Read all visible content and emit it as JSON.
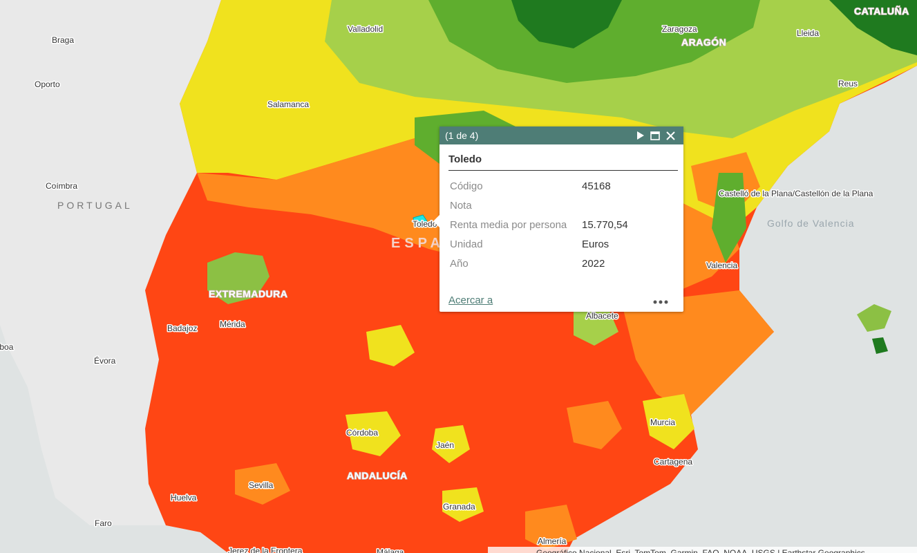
{
  "map": {
    "colors": {
      "sea": "#dfe3e3",
      "land_other": "#e8e8e8",
      "class_1": "#ff4614",
      "class_2": "#ff8a1e",
      "class_3": "#f0e21e",
      "class_4": "#a6d04a",
      "class_5": "#5fae2e",
      "class_6": "#1f7a1f",
      "selected": "#1ee6e6"
    },
    "labels": {
      "cities": [
        "Braga",
        "Oporto",
        "Valladolid",
        "Zaragoza",
        "Lleida",
        "Reus",
        "Salamanca",
        "Coímbra",
        "Toledo",
        "Castelló de la Plana/Castellón de la Plana",
        "Valencia",
        "Badajoz",
        "Mérida",
        "Albacete",
        "Évora",
        "Lisboa",
        "Murcia",
        "Córdoba",
        "Jaén",
        "Cartagena",
        "Sevilla",
        "Huelva",
        "Granada",
        "Faro",
        "Almería",
        "Málaga",
        "Jerez de la Frontera"
      ],
      "countries": [
        "PORTUGAL",
        "ESPAÑA"
      ],
      "regions": [
        "CATALUÑA",
        "ARAGÓN",
        "EXTREMADURA",
        "ANDALUCÍA"
      ],
      "seas": [
        "Golfo de Valencia"
      ]
    }
  },
  "popup": {
    "counter": "(1 de 4)",
    "icons": {
      "next": "play-icon",
      "maximize": "maximize-icon",
      "close": "close-icon"
    },
    "title": "Toledo",
    "fields": [
      {
        "label": "Código",
        "value": "45168"
      },
      {
        "label": "Nota",
        "value": ""
      },
      {
        "label": "Renta media por persona",
        "value": "15.770,54"
      },
      {
        "label": "Unidad",
        "value": "Euros"
      },
      {
        "label": "Año",
        "value": "2022"
      }
    ],
    "zoom_link": "Acercar a",
    "more_icon": "more-horizontal-icon"
  },
  "attribution": "Geográfico Nacional, Esri, TomTom, Garmin, FAO, NOAA, USGS | Earthstar Geographics"
}
